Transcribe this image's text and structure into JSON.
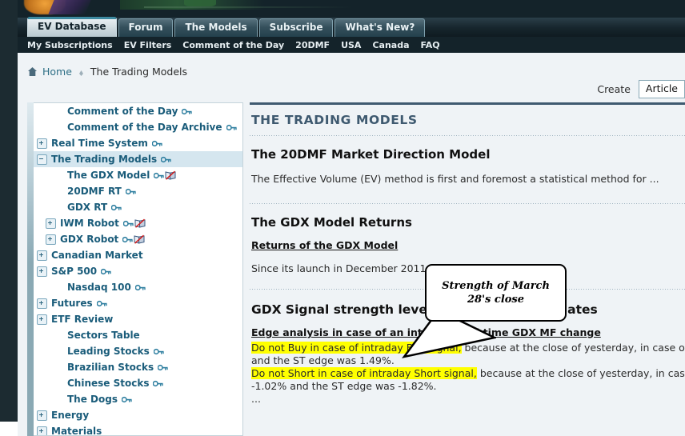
{
  "site": {
    "primary_tabs": [
      {
        "label": "EV Database",
        "active": true
      },
      {
        "label": "Forum",
        "active": false
      },
      {
        "label": "The Models",
        "active": false
      },
      {
        "label": "Subscribe",
        "active": false
      },
      {
        "label": "What's New?",
        "active": false
      }
    ],
    "secondary_nav": [
      {
        "label": "My Subscriptions"
      },
      {
        "label": "EV Filters"
      },
      {
        "label": "Comment of the Day"
      },
      {
        "label": "20DMF"
      },
      {
        "label": "USA"
      },
      {
        "label": "Canada"
      },
      {
        "label": "FAQ"
      }
    ]
  },
  "breadcrumb": {
    "home_label": "Home",
    "current_label": "The Trading Models",
    "home_icon": "home-icon",
    "separator_icon": "breadcrumb-separator-icon"
  },
  "create": {
    "label": "Create",
    "selected_option": "Article",
    "options": [
      "Article"
    ]
  },
  "sidebar": {
    "items": [
      {
        "label": "Comment of the Day",
        "toggle": "none",
        "indent": 1,
        "key": true,
        "book": false,
        "selected": false
      },
      {
        "label": "Comment of the Day Archive",
        "toggle": "none",
        "indent": 1,
        "key": true,
        "book": false,
        "selected": false
      },
      {
        "label": "Real Time System",
        "toggle": "plus",
        "indent": 0,
        "key": true,
        "book": false,
        "selected": false
      },
      {
        "label": "The Trading Models",
        "toggle": "minus",
        "indent": 0,
        "key": true,
        "book": false,
        "selected": true
      },
      {
        "label": "The GDX Model",
        "toggle": "none",
        "indent": 1,
        "key": true,
        "book": true,
        "selected": false
      },
      {
        "label": "20DMF RT",
        "toggle": "none",
        "indent": 1,
        "key": true,
        "book": false,
        "selected": false
      },
      {
        "label": "GDX RT",
        "toggle": "none",
        "indent": 1,
        "key": true,
        "book": false,
        "selected": false
      },
      {
        "label": "IWM Robot",
        "toggle": "plus",
        "indent": 2,
        "key": true,
        "book": true,
        "selected": false
      },
      {
        "label": "GDX Robot",
        "toggle": "plus",
        "indent": 2,
        "key": true,
        "book": true,
        "selected": false
      },
      {
        "label": "Canadian Market",
        "toggle": "plus",
        "indent": 0,
        "key": false,
        "book": false,
        "selected": false
      },
      {
        "label": "S&P 500",
        "toggle": "plus",
        "indent": 0,
        "key": true,
        "book": false,
        "selected": false
      },
      {
        "label": "Nasdaq 100",
        "toggle": "none",
        "indent": 1,
        "key": true,
        "book": false,
        "selected": false
      },
      {
        "label": "Futures",
        "toggle": "plus",
        "indent": 0,
        "key": true,
        "book": false,
        "selected": false
      },
      {
        "label": "ETF Review",
        "toggle": "plus",
        "indent": 0,
        "key": false,
        "book": false,
        "selected": false
      },
      {
        "label": "Sectors Table",
        "toggle": "none",
        "indent": 1,
        "key": false,
        "book": false,
        "selected": false
      },
      {
        "label": "Leading Stocks",
        "toggle": "none",
        "indent": 1,
        "key": true,
        "book": false,
        "selected": false
      },
      {
        "label": "Brazilian Stocks",
        "toggle": "none",
        "indent": 1,
        "key": true,
        "book": false,
        "selected": false
      },
      {
        "label": "Chinese Stocks",
        "toggle": "none",
        "indent": 1,
        "key": true,
        "book": false,
        "selected": false
      },
      {
        "label": "The Dogs",
        "toggle": "none",
        "indent": 1,
        "key": true,
        "book": false,
        "selected": false
      },
      {
        "label": "Energy",
        "toggle": "plus",
        "indent": 0,
        "key": false,
        "book": false,
        "selected": false
      },
      {
        "label": "Materials",
        "toggle": "plus",
        "indent": 0,
        "key": false,
        "book": false,
        "selected": false
      }
    ]
  },
  "main": {
    "page_title": "THE TRADING MODELS",
    "section1": {
      "heading": "The 20DMF Market Direction Model",
      "paragraph": "The Effective Volume (EV) method is first and foremost a statistical method for ..."
    },
    "section2": {
      "heading": "The GDX Model Returns",
      "link": "Returns of the GDX Model",
      "paragraph": "Since its launch in December 2011, as o"
    },
    "section3": {
      "heading": "GDX Signal strength levels and real time updates",
      "subheading": "Edge analysis in case of an intraday real time GDX MF change",
      "line1_highlight": "Do not Buy in case of intraday Buy signal,",
      "line1_rest": " because at the close of yesterday, in case of a Buy signal",
      "line2": "and the ST edge was 1.49%.",
      "line3_highlight": "Do not Short in case of intraday Short signal,",
      "line3_rest": " because at the close of yesterday, in case of a Short",
      "line4": "-1.02% and the ST edge was -1.82%.",
      "line5": "..."
    }
  },
  "callout": {
    "text": "Strength of March 28's close"
  },
  "colors": {
    "accent_teal": "#3d8aa0",
    "dark_nav": "#14232a",
    "sidebar_link": "#1a5c7a",
    "title_blue": "#3f5a70",
    "highlight_yellow": "#ffff00",
    "link_blue": "#2e6f86",
    "selected_row": "#d5e6ef"
  }
}
